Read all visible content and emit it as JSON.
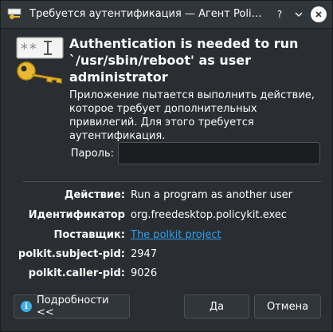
{
  "window": {
    "title": "Требуется аутентификация — Агент PolicyKit"
  },
  "dialog": {
    "heading": "Authentication is needed to run `/usr/sbin/reboot' as user administrator",
    "description": "Приложение пытается выполнить действие, которое требует дополнительных привилегий. Для этого требуется аутентификация.",
    "password_label": "Пароль:",
    "password_value": ""
  },
  "details": [
    {
      "key": "Действие:",
      "value": "Run a program as another user",
      "is_link": false
    },
    {
      "key": "Идентификатор",
      "value": "org.freedesktop.policykit.exec",
      "is_link": false
    },
    {
      "key": "Поставщик:",
      "value": "The polkit project",
      "is_link": true
    },
    {
      "key": "polkit.subject-pid:",
      "value": "2947",
      "is_link": false
    },
    {
      "key": "polkit.caller-pid:",
      "value": "9026",
      "is_link": false
    }
  ],
  "buttons": {
    "details": "Подробности <<",
    "ok": "Да",
    "cancel": "Отмена"
  },
  "colors": {
    "background": "#2a2e32",
    "link": "#2b9ff2",
    "accent": "#3daee9"
  }
}
